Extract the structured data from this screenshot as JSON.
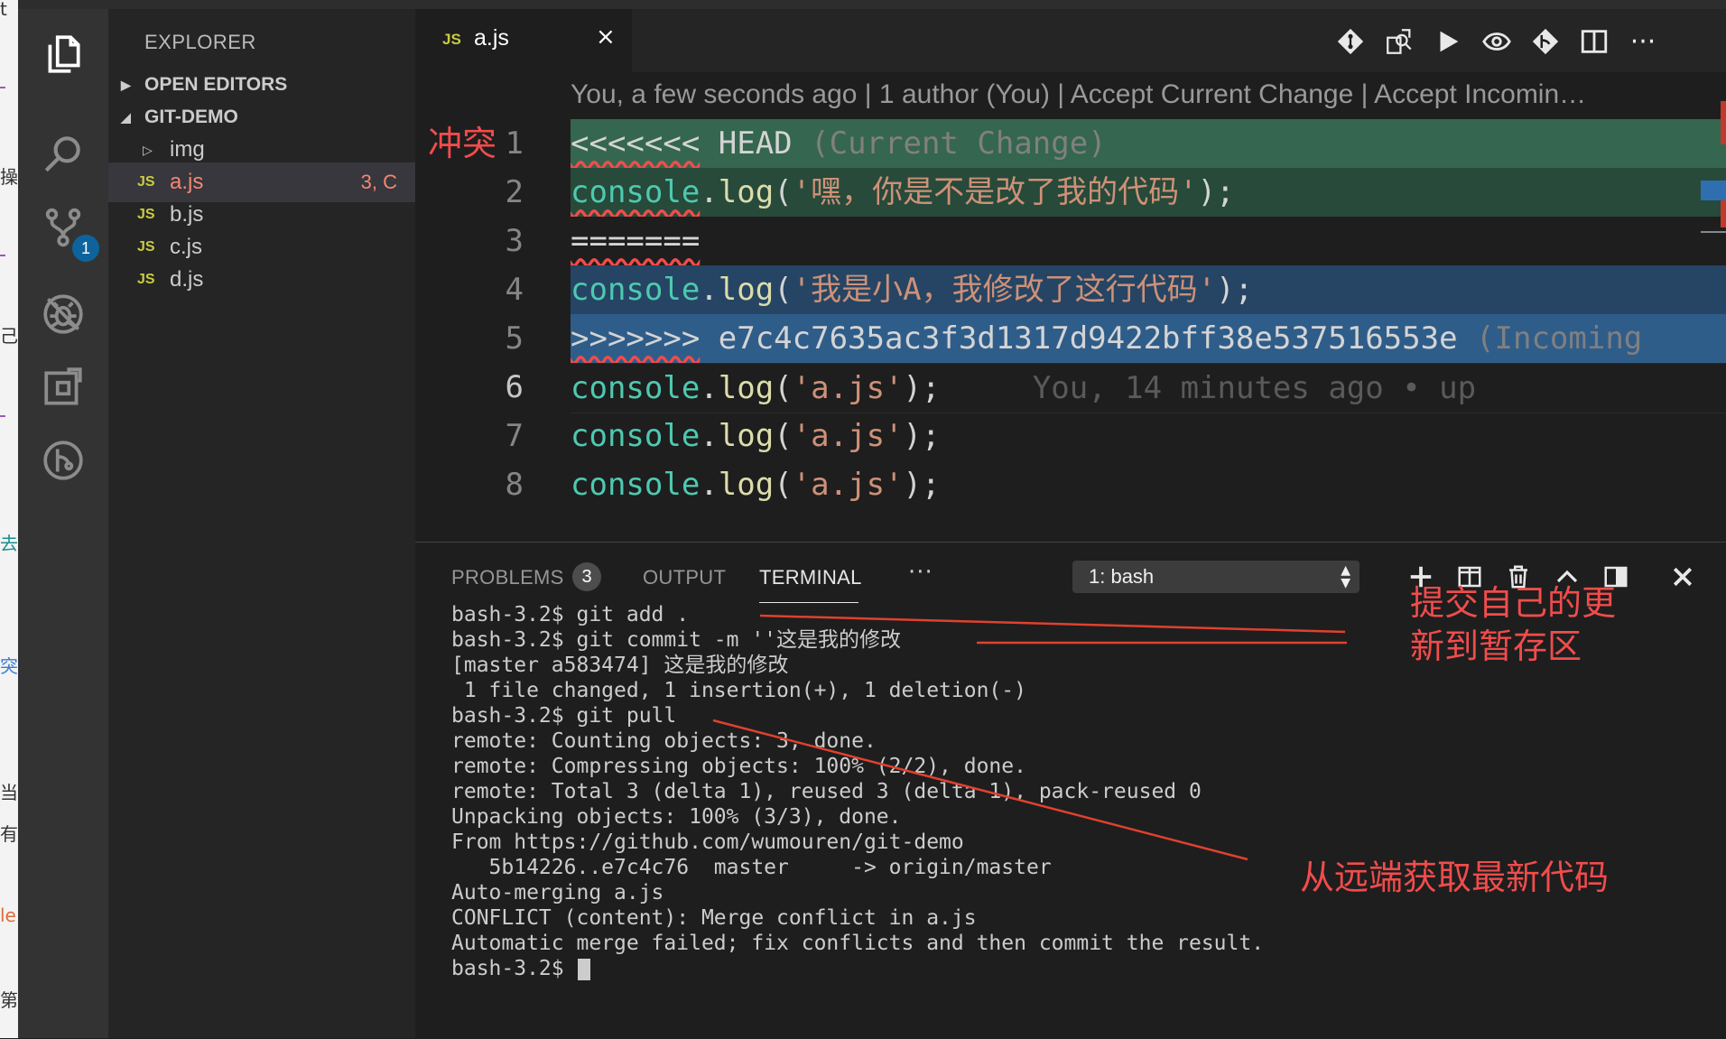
{
  "colors": {
    "accent": "#0e639c",
    "conflict_current_header": "#35664f",
    "conflict_current": "#274a3a",
    "conflict_incoming": "#264564",
    "conflict_incoming_header": "#2f5d8a",
    "annotation": "#f14c4c",
    "modified_file": "#f48771"
  },
  "activity_bar": {
    "icons": [
      "files-icon",
      "search-icon",
      "source-control-icon",
      "debug-icon",
      "extensions-icon",
      "gitlens-icon"
    ],
    "scm_badge": "1"
  },
  "sidebar": {
    "title": "EXPLORER",
    "sections": [
      {
        "label": "OPEN EDITORS",
        "expanded": false
      },
      {
        "label": "GIT-DEMO",
        "expanded": true
      }
    ],
    "tree": [
      {
        "type": "folder",
        "name": "img"
      },
      {
        "type": "file",
        "icon": "JS",
        "name": "a.js",
        "status": "3, C",
        "active": true
      },
      {
        "type": "file",
        "icon": "JS",
        "name": "b.js",
        "status": ""
      },
      {
        "type": "file",
        "icon": "JS",
        "name": "c.js",
        "status": ""
      },
      {
        "type": "file",
        "icon": "JS",
        "name": "d.js",
        "status": ""
      }
    ]
  },
  "tabs": [
    {
      "icon": "JS",
      "name": "a.js",
      "close": "×"
    }
  ],
  "toolbar_icons": [
    "git-compare-icon",
    "open-changes-icon",
    "run-icon",
    "toggle-history-icon",
    "git-commit-icon",
    "split-editor-icon",
    "more-actions-icon"
  ],
  "editor": {
    "codelens": "You, a few seconds ago | 1 author (You) | Accept Current Change | Accept Incomin…",
    "conflict_annotation": "冲突",
    "lines": [
      {
        "n": "1",
        "kind": "current-header",
        "parts": [
          {
            "t": "<<<<<<<",
            "c": "c-def squig"
          },
          {
            "t": " HEAD ",
            "c": "c-def"
          },
          {
            "t": "(Current Change)",
            "c": "c-grey"
          }
        ]
      },
      {
        "n": "2",
        "kind": "current",
        "parts": [
          {
            "t": "console",
            "c": "c-fn squig"
          },
          {
            "t": ".",
            "c": "c-def"
          },
          {
            "t": "log",
            "c": "c-mth"
          },
          {
            "t": "(",
            "c": "c-def"
          },
          {
            "t": "'嘿，你是不是改了我的代码'",
            "c": "c-str"
          },
          {
            "t": ");",
            "c": "c-def"
          }
        ]
      },
      {
        "n": "3",
        "kind": "separator",
        "parts": [
          {
            "t": "=======",
            "c": "c-def squig"
          }
        ]
      },
      {
        "n": "4",
        "kind": "incoming",
        "parts": [
          {
            "t": "console",
            "c": "c-fn"
          },
          {
            "t": ".",
            "c": "c-def"
          },
          {
            "t": "log",
            "c": "c-mth"
          },
          {
            "t": "(",
            "c": "c-def"
          },
          {
            "t": "'我是小A，我修改了这行代码'",
            "c": "c-str"
          },
          {
            "t": ");",
            "c": "c-def"
          }
        ]
      },
      {
        "n": "5",
        "kind": "incoming-header",
        "parts": [
          {
            "t": ">>>>>>>",
            "c": "c-def squig"
          },
          {
            "t": " e7c4c7635ac3f3d1317d9422bff38e537516553e ",
            "c": "c-def"
          },
          {
            "t": "(Incoming",
            "c": "c-grey"
          }
        ]
      },
      {
        "n": "6",
        "kind": "normal",
        "current": true,
        "parts": [
          {
            "t": "console",
            "c": "c-fn"
          },
          {
            "t": ".",
            "c": "c-def"
          },
          {
            "t": "log",
            "c": "c-mth"
          },
          {
            "t": "(",
            "c": "c-def"
          },
          {
            "t": "'a.js'",
            "c": "c-str"
          },
          {
            "t": ");",
            "c": "c-def"
          },
          {
            "t": "     You, 14 minutes ago • up",
            "c": "c-blame"
          }
        ]
      },
      {
        "n": "7",
        "kind": "normal",
        "parts": [
          {
            "t": "console",
            "c": "c-fn"
          },
          {
            "t": ".",
            "c": "c-def"
          },
          {
            "t": "log",
            "c": "c-mth"
          },
          {
            "t": "(",
            "c": "c-def"
          },
          {
            "t": "'a.js'",
            "c": "c-str"
          },
          {
            "t": ");",
            "c": "c-def"
          }
        ]
      },
      {
        "n": "8",
        "kind": "normal",
        "parts": [
          {
            "t": "console",
            "c": "c-fn"
          },
          {
            "t": ".",
            "c": "c-def"
          },
          {
            "t": "log",
            "c": "c-mth"
          },
          {
            "t": "(",
            "c": "c-def"
          },
          {
            "t": "'a.js'",
            "c": "c-str"
          },
          {
            "t": ");",
            "c": "c-def"
          }
        ]
      }
    ]
  },
  "panel": {
    "tabs": {
      "problems": "PROBLEMS",
      "problems_count": "3",
      "output": "OUTPUT",
      "terminal": "TERMINAL",
      "more": "···"
    },
    "terminal_select": "1: bash",
    "icons": [
      "new-terminal-icon",
      "split-terminal-icon",
      "kill-terminal-icon",
      "maximize-panel-icon",
      "toggle-panel-position-icon",
      "close-panel-icon"
    ],
    "terminal_lines": [
      "bash-3.2$ git add .",
      "bash-3.2$ git commit -m ''这是我的修改",
      "[master a583474] 这是我的修改",
      " 1 file changed, 1 insertion(+), 1 deletion(-)",
      "bash-3.2$ git pull",
      "remote: Counting objects: 3, done.",
      "remote: Compressing objects: 100% (2/2), done.",
      "remote: Total 3 (delta 1), reused 3 (delta 1), pack-reused 0",
      "Unpacking objects: 100% (3/3), done.",
      "From https://github.com/wumouren/git-demo",
      "   5b14226..e7c4c76  master     -> origin/master",
      "Auto-merging a.js",
      "CONFLICT (content): Merge conflict in a.js",
      "Automatic merge failed; fix conflicts and then commit the result."
    ],
    "prompt": "bash-3.2$ "
  },
  "annotations": {
    "commit_note_line1": "提交自己的更",
    "commit_note_line2": "新到暂存区",
    "pull_note": "从远端获取最新代码"
  },
  "left_strip_chars": [
    "t",
    "操",
    "己",
    "去",
    "突",
    "当",
    "有",
    "le",
    "第"
  ]
}
